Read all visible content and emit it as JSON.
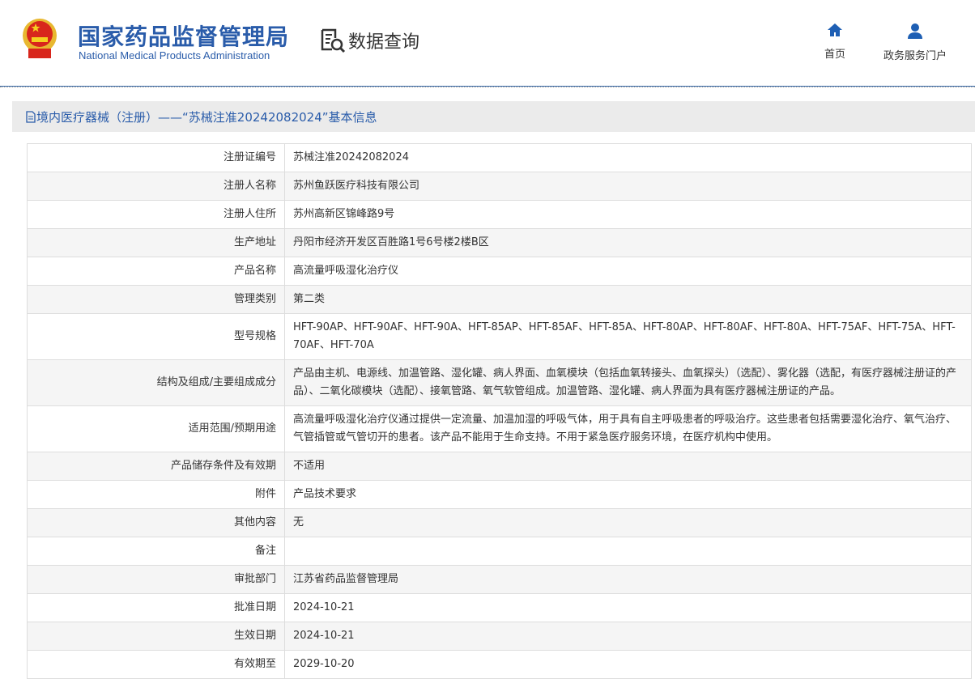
{
  "header": {
    "org_cn": "国家药品监督管理局",
    "org_en": "National Medical Products Administration",
    "section": "数据查询",
    "nav": [
      {
        "label": "首页"
      },
      {
        "label": "政务服务门户"
      }
    ]
  },
  "title": "境内医疗器械（注册）——“苏械注准20242082024”基本信息",
  "rows": [
    {
      "label": "注册证编号",
      "value": "苏械注准20242082024"
    },
    {
      "label": "注册人名称",
      "value": "苏州鱼跃医疗科技有限公司"
    },
    {
      "label": "注册人住所",
      "value": "苏州高新区锦峰路9号"
    },
    {
      "label": "生产地址",
      "value": "丹阳市经济开发区百胜路1号6号楼2楼B区"
    },
    {
      "label": "产品名称",
      "value": "高流量呼吸湿化治疗仪"
    },
    {
      "label": "管理类别",
      "value": "第二类"
    },
    {
      "label": "型号规格",
      "value": "HFT-90AP、HFT-90AF、HFT-90A、HFT-85AP、HFT-85AF、HFT-85A、HFT-80AP、HFT-80AF、HFT-80A、HFT-75AF、HFT-75A、HFT-70AF、HFT-70A"
    },
    {
      "label": "结构及组成/主要组成成分",
      "value": "产品由主机、电源线、加温管路、湿化罐、病人界面、血氧模块（包括血氧转接头、血氧探头）（选配）、雾化器（选配，有医疗器械注册证的产品）、二氧化碳模块（选配）、接氧管路、氧气软管组成。加温管路、湿化罐、病人界面为具有医疗器械注册证的产品。"
    },
    {
      "label": "适用范围/预期用途",
      "value": "高流量呼吸湿化治疗仪通过提供一定流量、加温加湿的呼吸气体，用于具有自主呼吸患者的呼吸治疗。这些患者包括需要湿化治疗、氧气治疗、气管插管或气管切开的患者。该产品不能用于生命支持。不用于紧急医疗服务环境，在医疗机构中使用。"
    },
    {
      "label": "产品储存条件及有效期",
      "value": "不适用"
    },
    {
      "label": "附件",
      "value": "产品技术要求"
    },
    {
      "label": "其他内容",
      "value": "无"
    },
    {
      "label": "备注",
      "value": ""
    },
    {
      "label": "审批部门",
      "value": "江苏省药品监督管理局"
    },
    {
      "label": "批准日期",
      "value": "2024-10-21"
    },
    {
      "label": "生效日期",
      "value": "2024-10-21"
    },
    {
      "label": "有效期至",
      "value": "2029-10-20"
    }
  ]
}
